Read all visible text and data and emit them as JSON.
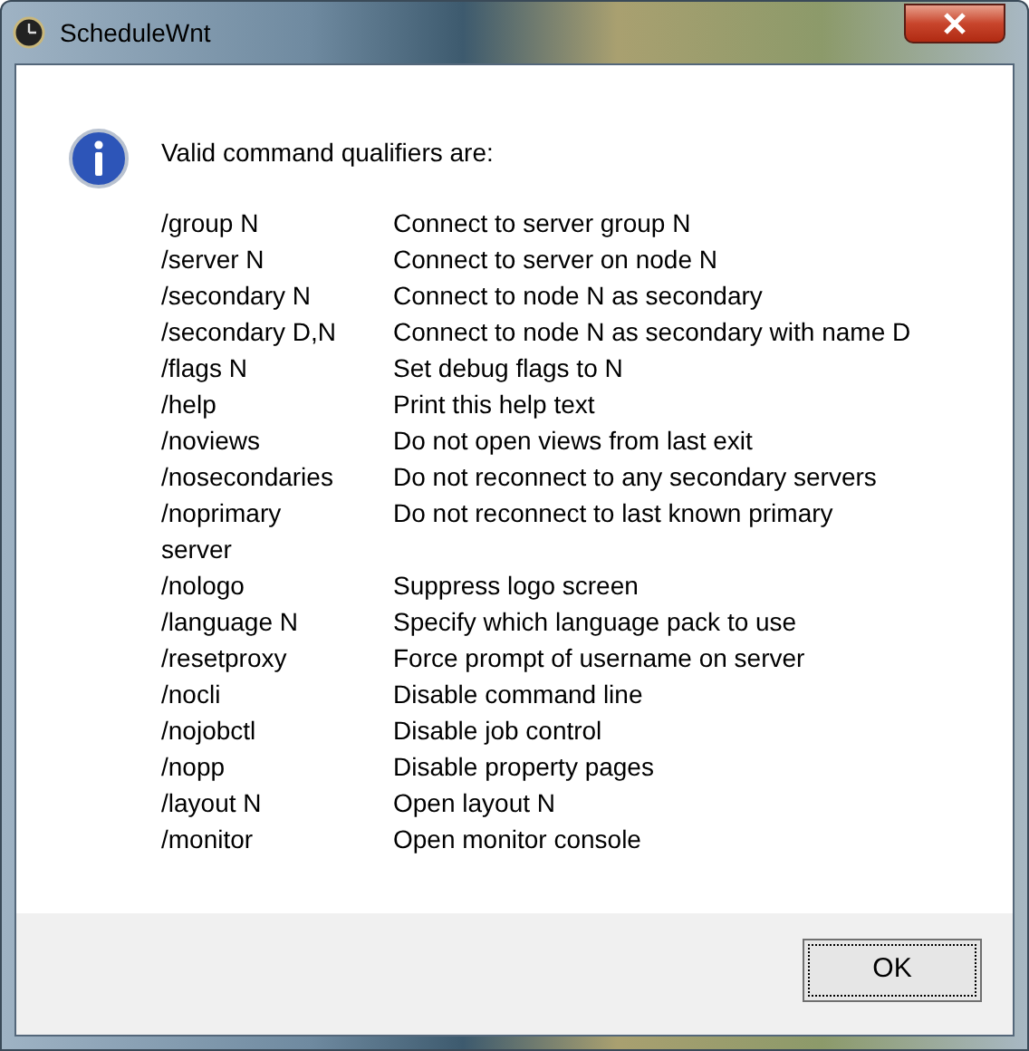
{
  "window": {
    "title": "ScheduleWnt"
  },
  "message": {
    "heading": "Valid command qualifiers are:",
    "rows": [
      {
        "qualifier": "/group N",
        "description": "Connect to server group N"
      },
      {
        "qualifier": "/server N",
        "description": "Connect to server on node N"
      },
      {
        "qualifier": "/secondary N",
        "description": "Connect to node N as secondary"
      },
      {
        "qualifier": "/secondary D,N",
        "description": "Connect to node N as secondary with name D"
      },
      {
        "qualifier": "/flags N",
        "description": "Set debug flags to N"
      },
      {
        "qualifier": "/help",
        "description": "Print this help text"
      },
      {
        "qualifier": "/noviews",
        "description": "Do not open views from last exit"
      },
      {
        "qualifier": "/nosecondaries",
        "description": "Do not reconnect to any secondary servers"
      },
      {
        "qualifier": "/noprimary server",
        "description": "Do not reconnect to last known primary"
      },
      {
        "qualifier": "/nologo",
        "description": "Suppress logo screen"
      },
      {
        "qualifier": "/language N",
        "description": "Specify which language pack to use"
      },
      {
        "qualifier": "/resetproxy",
        "description": "Force prompt of username on server"
      },
      {
        "qualifier": "/nocli",
        "description": "Disable command line"
      },
      {
        "qualifier": "/nojobctl",
        "description": "Disable job control"
      },
      {
        "qualifier": "/nopp",
        "description": "Disable property pages"
      },
      {
        "qualifier": "/layout N",
        "description": "Open layout N"
      },
      {
        "qualifier": "/monitor",
        "description": "Open monitor console"
      }
    ]
  },
  "buttons": [
    {
      "label": "OK"
    }
  ]
}
